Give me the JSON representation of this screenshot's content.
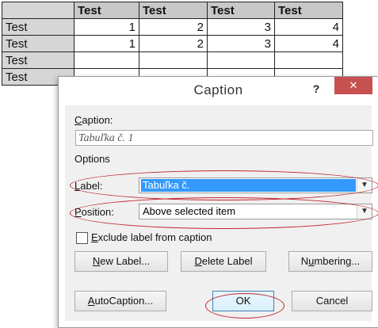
{
  "table": {
    "headers": [
      "Test",
      "Test",
      "Test",
      "Test"
    ],
    "rows": [
      {
        "label": "Test",
        "cells": [
          "1",
          "2",
          "3",
          "4"
        ]
      },
      {
        "label": "Test",
        "cells": [
          "1",
          "2",
          "3",
          "4"
        ]
      },
      {
        "label": "Test",
        "cells": []
      },
      {
        "label": "Test",
        "cells": []
      }
    ]
  },
  "dialog": {
    "title": "Caption",
    "help_glyph": "?",
    "close_glyph": "✕",
    "caption_label": "Caption:",
    "caption_value": "Tabuľka č. 1",
    "options_label": "Options",
    "label_label": "Label:",
    "label_value": "Tabuľka č.",
    "position_label": "Position:",
    "position_value": "Above selected item",
    "exclude_label": "Exclude label from caption",
    "exclude_checked": false,
    "new_label_button": "New Label...",
    "delete_label_button": "Delete Label",
    "numbering_button": "Numbering...",
    "autocaption_button": "AutoCaption...",
    "ok_button": "OK",
    "cancel_button": "Cancel"
  },
  "colors": {
    "selection": "#3399ff",
    "close_button": "#c75050",
    "annotation": "#c0262d"
  }
}
